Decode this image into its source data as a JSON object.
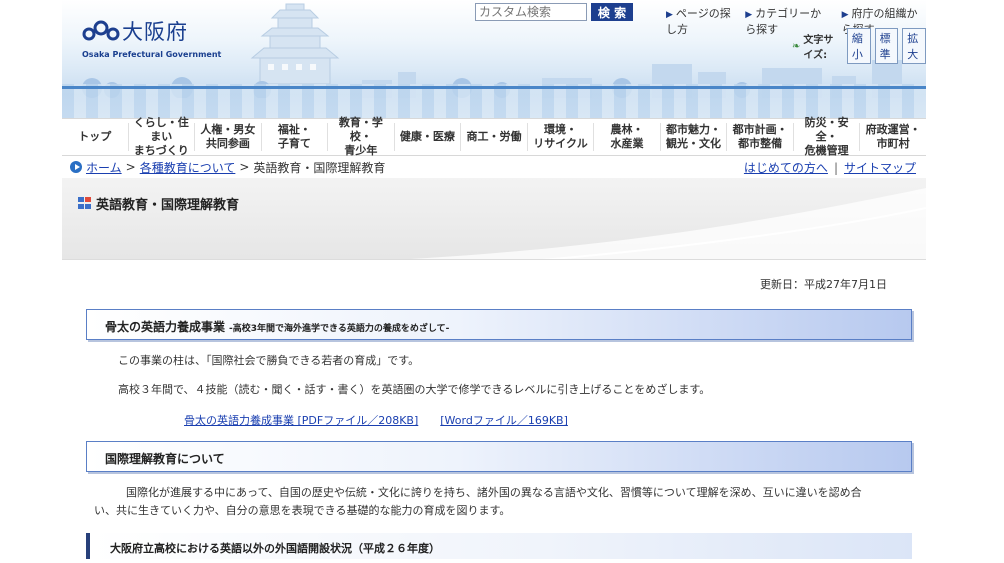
{
  "header": {
    "logo_text": "大阪府",
    "logo_sub": "Osaka Prefectural Government",
    "search_placeholder": "カスタム検索",
    "search_button": "検 索",
    "top_links": [
      "ページの探し方",
      "カテゴリーから探す",
      "府庁の組織から探す"
    ],
    "font_size_label": "文字サイズ:",
    "font_size_buttons": [
      "縮小",
      "標準",
      "拡大"
    ]
  },
  "nav": {
    "items": [
      "トップ",
      "くらし・住まい\nまちづくり",
      "人権・男女\n共同参画",
      "福祉・\n子育て",
      "教育・学校・\n青少年",
      "健康・医療",
      "商工・労働",
      "環境・\nリサイクル",
      "農林・\n水産業",
      "都市魅力・\n観光・文化",
      "都市計画・\n都市整備",
      "防災・安全・\n危機管理",
      "府政運営・\n市町村"
    ]
  },
  "breadcrumb": {
    "home": "ホーム",
    "parent": "各種教育について",
    "current": "英語教育・国際理解教育",
    "first_visit": "はじめての方へ",
    "sitemap": "サイトマップ"
  },
  "page": {
    "title": "英語教育・国際理解教育",
    "updated": "更新日：平成27年7月1日"
  },
  "section1": {
    "heading": "骨太の英語力養成事業",
    "subheading": "-高校3年間で海外進学できる英語力の養成をめざして-",
    "para1": "この事業の柱は、「国際社会で勝負できる若者の育成」です。",
    "para2": "高校３年間で、４技能（読む・聞く・話す・書く）を英語圏の大学で修学できるレベルに引き上げることをめざします。",
    "link_pdf": "骨太の英語力養成事業 [PDFファイル／208KB]",
    "link_word": "[Wordファイル／169KB]"
  },
  "section2": {
    "heading": "国際理解教育について",
    "para_line1": "国際化が進展する中にあって、自国の歴史や伝統・文化に誇りを持ち、諸外国の異なる言語や文化、習慣等について理解を深め、互いに違いを認め合",
    "para_line2": "い、共に生きていく力や、自分の意思を表現できる基礎的な能力の育成を図ります。"
  },
  "section3": {
    "heading": "大阪府立高校における英語以外の外国語開設状況（平成２６年度）"
  },
  "colors": {
    "brand_blue": "#1d3f8f",
    "link": "#1a3fb0",
    "heading_border": "#5a7fc6"
  }
}
